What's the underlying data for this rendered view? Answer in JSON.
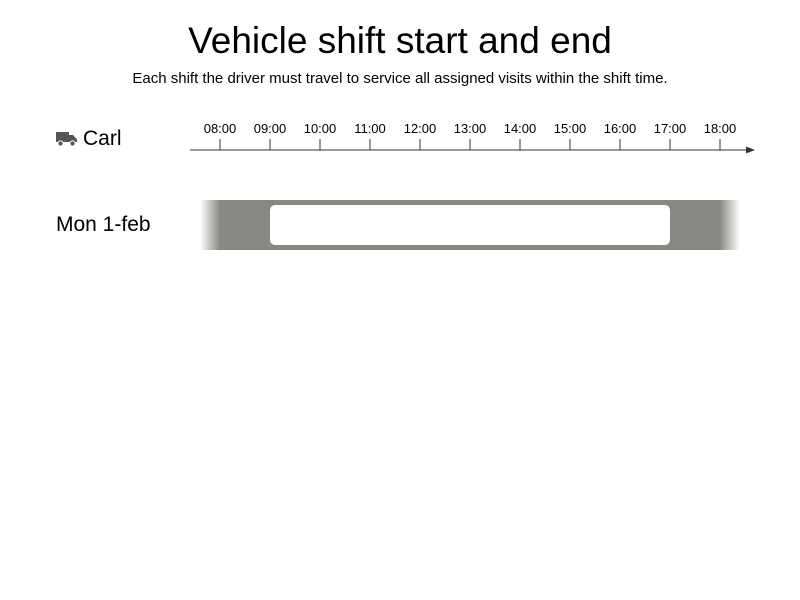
{
  "header": {
    "title": "Vehicle shift start and end",
    "subtitle": "Each shift the driver must travel to service all assigned visits within the shift time."
  },
  "vehicle": {
    "name": "Carl",
    "icon": "truck-icon"
  },
  "timeline": {
    "ticks": [
      "08:00",
      "09:00",
      "10:00",
      "11:00",
      "12:00",
      "13:00",
      "14:00",
      "15:00",
      "16:00",
      "17:00",
      "18:00"
    ]
  },
  "rows": [
    {
      "label": "Mon 1-feb",
      "shift": {
        "start": "07:40",
        "end": "18:20"
      },
      "window": {
        "start": "09:00",
        "end": "17:00"
      }
    }
  ],
  "colors": {
    "shift": "#888882",
    "window": "#ffffff",
    "icon": "#555555"
  }
}
